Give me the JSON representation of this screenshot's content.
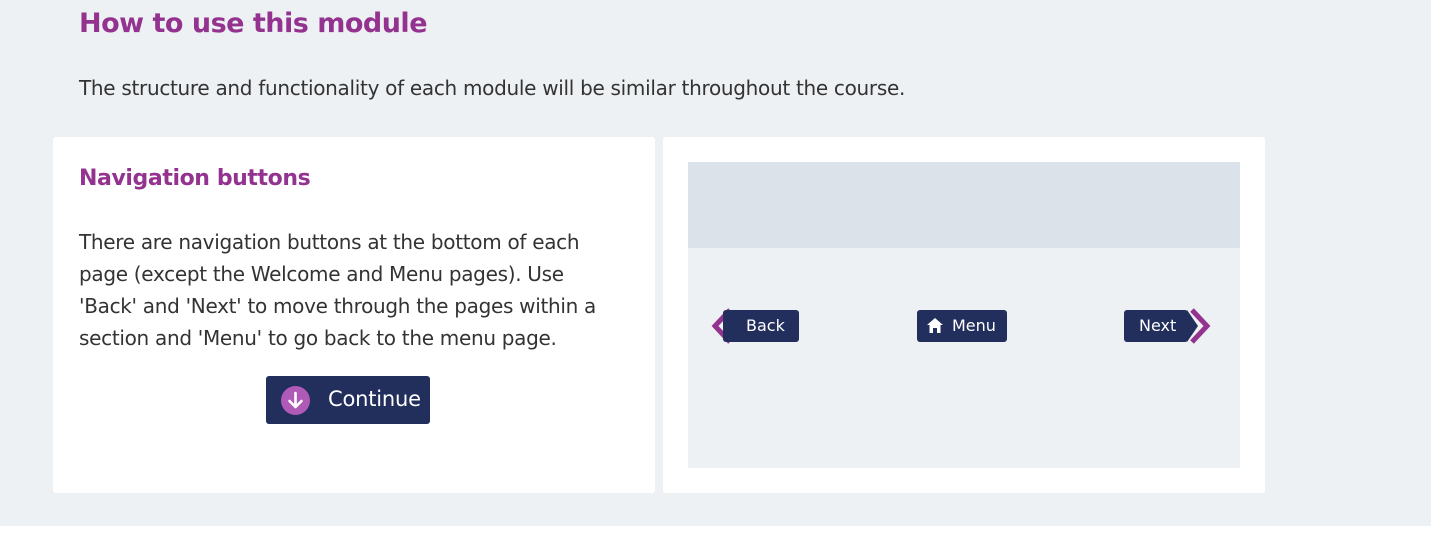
{
  "page": {
    "title": "How to use this module",
    "intro": "The structure and functionality of each module will be similar throughout the course."
  },
  "card": {
    "title": "Navigation buttons",
    "body": "There are navigation buttons at the bottom of each page (except the Welcome and Menu pages). Use 'Back' and 'Next' to move through the pages within a section and 'Menu' to go back to the menu page.",
    "continue_label": "Continue",
    "continue_icon": "arrow-down-circle-icon"
  },
  "preview": {
    "back_label": "Back",
    "menu_label": "Menu",
    "next_label": "Next",
    "back_icon": "chevron-left-icon",
    "menu_icon": "home-icon",
    "next_icon": "chevron-right-icon"
  },
  "colors": {
    "heading": "#93338f",
    "button": "#222e5c",
    "background": "#eef1f4",
    "preview_header": "#dbe2ea",
    "icon_accent": "#b05ab8"
  }
}
